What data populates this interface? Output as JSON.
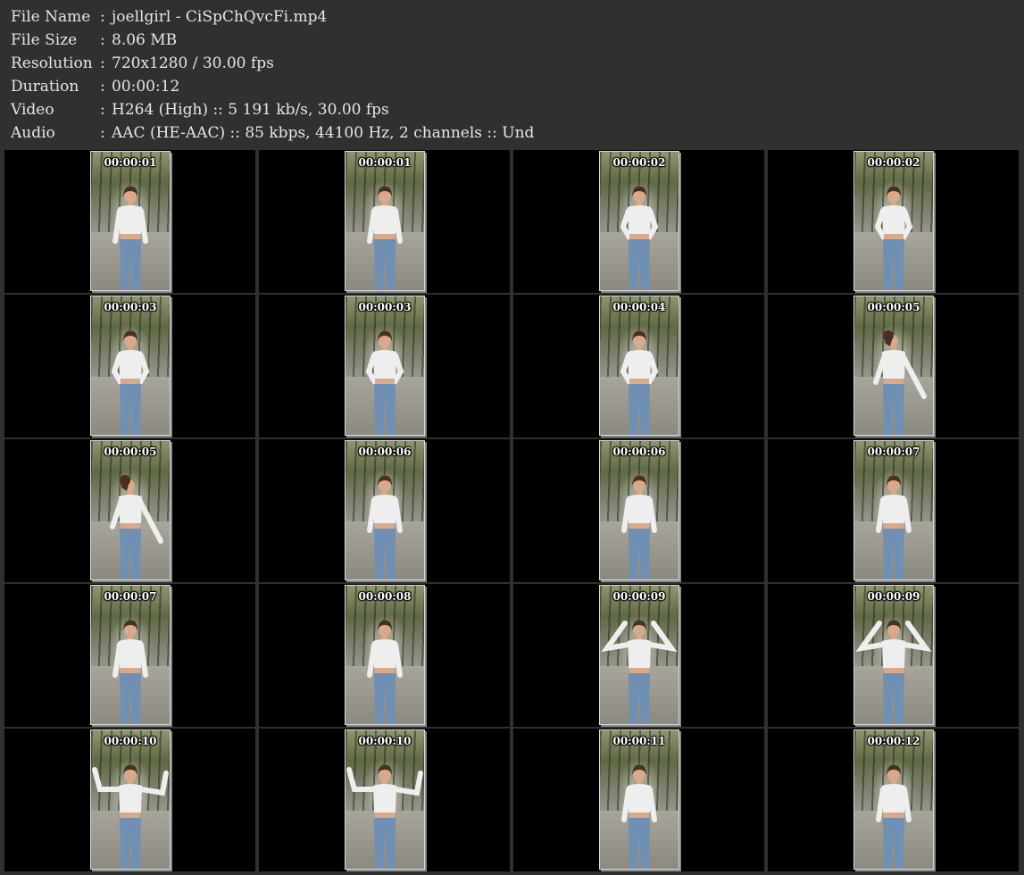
{
  "info": [
    {
      "key": "File Name",
      "sep": ":",
      "value": "joellgirl - CiSpChQvcFi.mp4"
    },
    {
      "key": "File Size",
      "sep": ":",
      "value": "8.06 MB"
    },
    {
      "key": "Resolution",
      "sep": ":",
      "value": "720x1280 / 30.00 fps"
    },
    {
      "key": "Duration",
      "sep": ":",
      "value": "00:00:12"
    },
    {
      "key": "Video",
      "sep": ":",
      "value": "H264 (High) :: 5 191 kb/s, 30.00 fps"
    },
    {
      "key": "Audio",
      "sep": ":",
      "value": "AAC (HE-AAC) :: 85 kbps, 44100 Hz, 2 channels :: Und"
    }
  ],
  "colors": {
    "background": "#303030",
    "cell": "#000000",
    "text": "#e6e6e6",
    "skin": "#d9a98a",
    "top": "#eeeeee",
    "jeans": "#6f8fb3",
    "hair": "#4a2f22"
  },
  "frames": [
    {
      "timestamp": "00:00:01",
      "pose": "walk"
    },
    {
      "timestamp": "00:00:01",
      "pose": "walk"
    },
    {
      "timestamp": "00:00:02",
      "pose": "hands-hips"
    },
    {
      "timestamp": "00:00:02",
      "pose": "hands-hips"
    },
    {
      "timestamp": "00:00:03",
      "pose": "hands-hips"
    },
    {
      "timestamp": "00:00:03",
      "pose": "hands-hips"
    },
    {
      "timestamp": "00:00:04",
      "pose": "hands-hips"
    },
    {
      "timestamp": "00:00:05",
      "pose": "turn"
    },
    {
      "timestamp": "00:00:05",
      "pose": "turn"
    },
    {
      "timestamp": "00:00:06",
      "pose": "walk"
    },
    {
      "timestamp": "00:00:06",
      "pose": "walk"
    },
    {
      "timestamp": "00:00:07",
      "pose": "walk"
    },
    {
      "timestamp": "00:00:07",
      "pose": "walk"
    },
    {
      "timestamp": "00:00:08",
      "pose": "walk"
    },
    {
      "timestamp": "00:00:09",
      "pose": "arms-up"
    },
    {
      "timestamp": "00:00:09",
      "pose": "arms-up"
    },
    {
      "timestamp": "00:00:10",
      "pose": "wave"
    },
    {
      "timestamp": "00:00:10",
      "pose": "wave"
    },
    {
      "timestamp": "00:00:11",
      "pose": "walk"
    },
    {
      "timestamp": "00:00:12",
      "pose": "walk"
    }
  ]
}
